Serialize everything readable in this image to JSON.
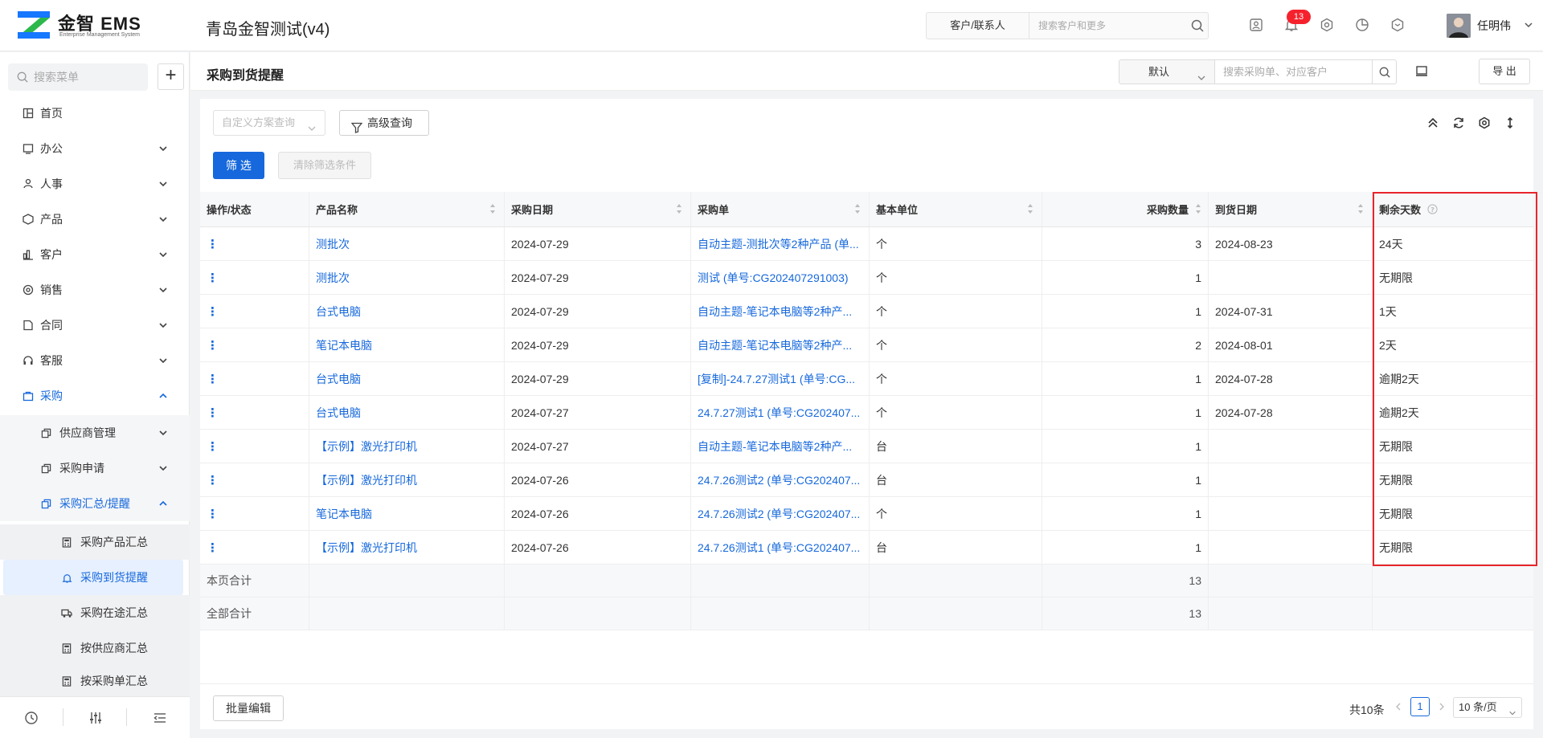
{
  "app": {
    "logo_text": "金智 EMS",
    "logo_sub": "Enterprise Management System",
    "title": "青岛金智测试(v4)"
  },
  "topbar": {
    "scope": "客户/联系人",
    "search_placeholder": "搜索客户和更多",
    "notification_count": "13",
    "user_name": "任明伟",
    "icons": [
      "contact-card-icon",
      "bell-icon",
      "gear-icon",
      "pie-chart-icon",
      "cube-icon"
    ]
  },
  "sidebar": {
    "search_placeholder": "搜索菜单",
    "add_label": "+",
    "items": [
      {
        "label": "首页",
        "icon": "home-icon"
      },
      {
        "label": "办公",
        "icon": "office-icon"
      },
      {
        "label": "人事",
        "icon": "people-icon"
      },
      {
        "label": "产品",
        "icon": "box-icon"
      },
      {
        "label": "客户",
        "icon": "customer-icon"
      },
      {
        "label": "销售",
        "icon": "sales-icon"
      },
      {
        "label": "合同",
        "icon": "contract-icon"
      },
      {
        "label": "客服",
        "icon": "headset-icon"
      },
      {
        "label": "采购",
        "icon": "purchase-icon"
      },
      {
        "label": "供应商管理",
        "icon": "copy-icon"
      },
      {
        "label": "采购申请",
        "icon": "copy-icon"
      },
      {
        "label": "采购汇总/提醒",
        "icon": "copy-icon"
      },
      {
        "label": "采购产品汇总",
        "icon": "calculator-icon"
      },
      {
        "label": "采购到货提醒",
        "icon": "bell-user-icon"
      },
      {
        "label": "采购在途汇总",
        "icon": "truck-icon"
      },
      {
        "label": "按供应商汇总",
        "icon": "calculator-icon"
      },
      {
        "label": "按采购单汇总",
        "icon": "calculator-icon"
      }
    ],
    "footer_icons": [
      "history-icon",
      "sliders-icon",
      "collapse-menu-icon"
    ]
  },
  "page": {
    "title": "采购到货提醒",
    "view": "默认",
    "search_placeholder": "搜索采购单、对应客户",
    "export_label": "导 出"
  },
  "filters": {
    "custom_query_placeholder": "自定义方案查询",
    "advanced_query": "高级查询",
    "filter_button": "筛 选",
    "clear_button": "清除筛选条件"
  },
  "table": {
    "columns": [
      "操作/状态",
      "产品名称",
      "采购日期",
      "采购单",
      "基本单位",
      "采购数量",
      "到货日期",
      "剩余天数"
    ],
    "rows": [
      {
        "op": "⋮",
        "product": "测批次",
        "date": "2024-07-29",
        "order": "自动主题-测批次等2种产品 (单...",
        "unit": "个",
        "qty": "3",
        "arrival": "2024-08-23",
        "remaining": "24天"
      },
      {
        "op": "⋮",
        "product": "测批次",
        "date": "2024-07-29",
        "order": "测试 (单号:CG202407291003)",
        "unit": "个",
        "qty": "1",
        "arrival": "",
        "remaining": "无期限"
      },
      {
        "op": "⋮",
        "product": "台式电脑",
        "date": "2024-07-29",
        "order": "自动主题-笔记本电脑等2种产...",
        "unit": "个",
        "qty": "1",
        "arrival": "2024-07-31",
        "remaining": "1天"
      },
      {
        "op": "⋮",
        "product": "笔记本电脑",
        "date": "2024-07-29",
        "order": "自动主题-笔记本电脑等2种产...",
        "unit": "个",
        "qty": "2",
        "arrival": "2024-08-01",
        "remaining": "2天"
      },
      {
        "op": "⋮",
        "product": "台式电脑",
        "date": "2024-07-29",
        "order": "[复制]-24.7.27测试1 (单号:CG...",
        "unit": "个",
        "qty": "1",
        "arrival": "2024-07-28",
        "remaining": "逾期2天"
      },
      {
        "op": "⋮",
        "product": "台式电脑",
        "date": "2024-07-27",
        "order": "24.7.27测试1 (单号:CG202407...",
        "unit": "个",
        "qty": "1",
        "arrival": "2024-07-28",
        "remaining": "逾期2天"
      },
      {
        "op": "⋮",
        "product": "【示例】激光打印机",
        "date": "2024-07-27",
        "order": "自动主题-笔记本电脑等2种产...",
        "unit": "台",
        "qty": "1",
        "arrival": "",
        "remaining": "无期限"
      },
      {
        "op": "⋮",
        "product": "【示例】激光打印机",
        "date": "2024-07-26",
        "order": "24.7.26测试2 (单号:CG202407...",
        "unit": "台",
        "qty": "1",
        "arrival": "",
        "remaining": "无期限"
      },
      {
        "op": "⋮",
        "product": "笔记本电脑",
        "date": "2024-07-26",
        "order": "24.7.26测试2 (单号:CG202407...",
        "unit": "个",
        "qty": "1",
        "arrival": "",
        "remaining": "无期限"
      },
      {
        "op": "⋮",
        "product": "【示例】激光打印机",
        "date": "2024-07-26",
        "order": "24.7.26测试1 (单号:CG202407...",
        "unit": "台",
        "qty": "1",
        "arrival": "",
        "remaining": "无期限"
      }
    ],
    "page_total_label": "本页合计",
    "page_total_qty": "13",
    "all_total_label": "全部合计",
    "all_total_qty": "13"
  },
  "footer": {
    "batch_edit": "批量编辑",
    "total_text": "共10条",
    "current_page": "1",
    "page_size": "10 条/页"
  },
  "colors": {
    "accent": "#1668dc",
    "badge": "#f5222d",
    "highlight": "#e8252b"
  }
}
